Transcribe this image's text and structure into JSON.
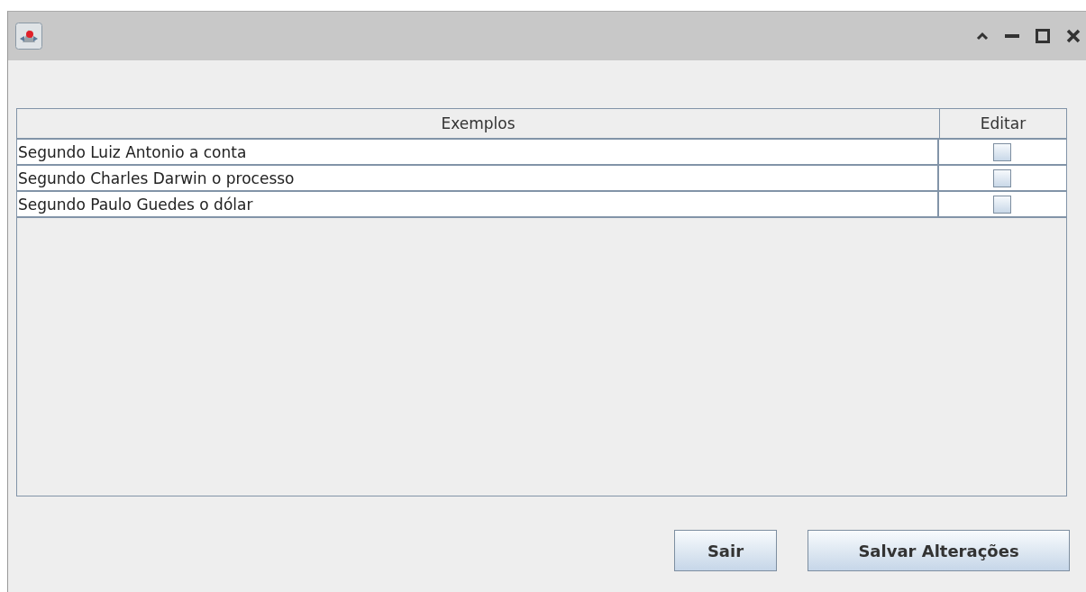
{
  "table": {
    "columns": [
      "Exemplos",
      "Editar"
    ],
    "rows": [
      {
        "exemplo": "Segundo Luiz Antonio a conta",
        "editar": false
      },
      {
        "exemplo": "Segundo Charles Darwin o processo",
        "editar": false
      },
      {
        "exemplo": "Segundo Paulo Guedes o dólar",
        "editar": false
      }
    ]
  },
  "buttons": [
    "Sair",
    "Salvar Alterações"
  ]
}
